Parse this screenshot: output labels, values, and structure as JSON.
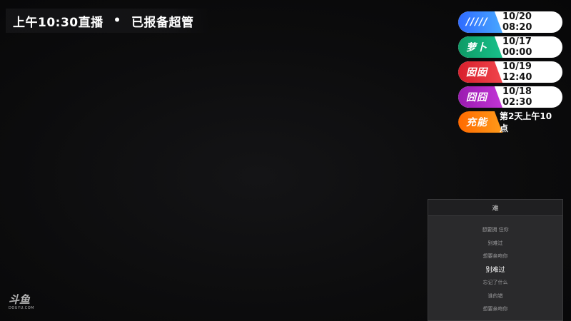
{
  "banner": {
    "time_text": "上午10:30直播",
    "separator": "•",
    "status_text": "已报备超管"
  },
  "schedule": [
    {
      "badge": "/////",
      "time": "10/20 08:20",
      "color_from": "#2f6bff",
      "color_to": "#48a7ff"
    },
    {
      "badge": "萝卜",
      "time": "10/17 00:00",
      "color_from": "#0e9b66",
      "color_to": "#18c08a"
    },
    {
      "badge": "囡囡",
      "time": "10/19 12:40",
      "color_from": "#d81f2c",
      "color_to": "#f0454c"
    },
    {
      "badge": "囧囧",
      "time": "10/18 02:30",
      "color_from": "#9a1bb0",
      "color_to": "#c235d6"
    },
    {
      "badge": "充能",
      "time": "第2天上午10点",
      "color_from": "#ff6a00",
      "color_to": "#ff9a1a"
    }
  ],
  "lyrics": {
    "title": "难",
    "lines": [
      "想要拥 住你",
      "别难过",
      "想要亲吻你",
      "别难过",
      "忘记了什么",
      "谁的错",
      "想要亲吻你"
    ],
    "active_index": 3
  },
  "watermark": {
    "main": "斗鱼",
    "sub": "DOUYU.COM"
  }
}
